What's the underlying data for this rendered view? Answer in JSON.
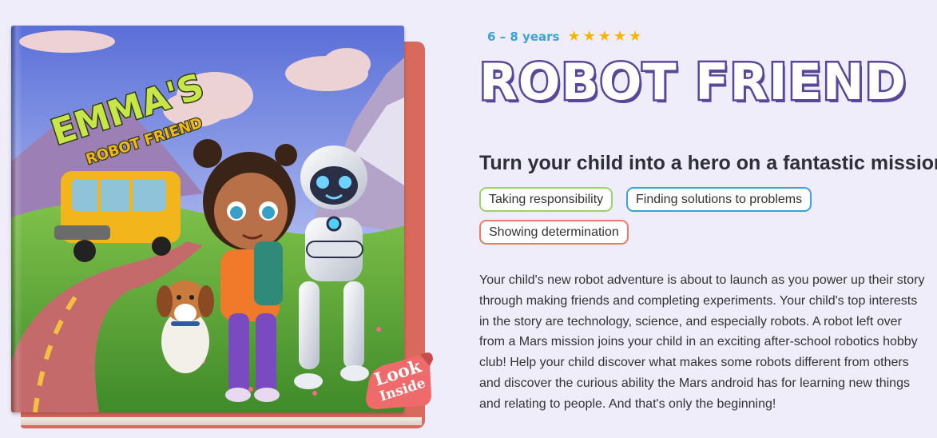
{
  "book": {
    "cover_title_name": "EMMA'S",
    "cover_title_rest": "ROBOT FRIEND",
    "look_inside_line1": "Look",
    "look_inside_line2": "Inside"
  },
  "product": {
    "age_range": "6 – 8 years",
    "rating_stars": 5,
    "star_glyph": "★",
    "title": "ROBOT FRIEND",
    "subtitle": "Turn your child into a hero on a fantastic mission",
    "tags": [
      {
        "label": "Taking responsibility",
        "color": "#9bd26a"
      },
      {
        "label": "Finding solutions to problems",
        "color": "#3ba3d6"
      },
      {
        "label": "Showing determination",
        "color": "#ec7a6a"
      }
    ],
    "description": "Your child's new robot adventure is about to launch as you power up their story through making friends and completing experiments. Your child's top interests in the story are technology, science, and especially robots. A robot left over from a Mars mission joins your child in an exciting after-school robotics hobby club! Help your child discover what makes some robots different from others and discover the curious ability the Mars android has for learning new things and relating to people. And that's only the beginning!"
  },
  "colors": {
    "background": "#efedf9",
    "title_outline": "#59479a",
    "age_text": "#3ba3d6",
    "star": "#f7b500"
  }
}
